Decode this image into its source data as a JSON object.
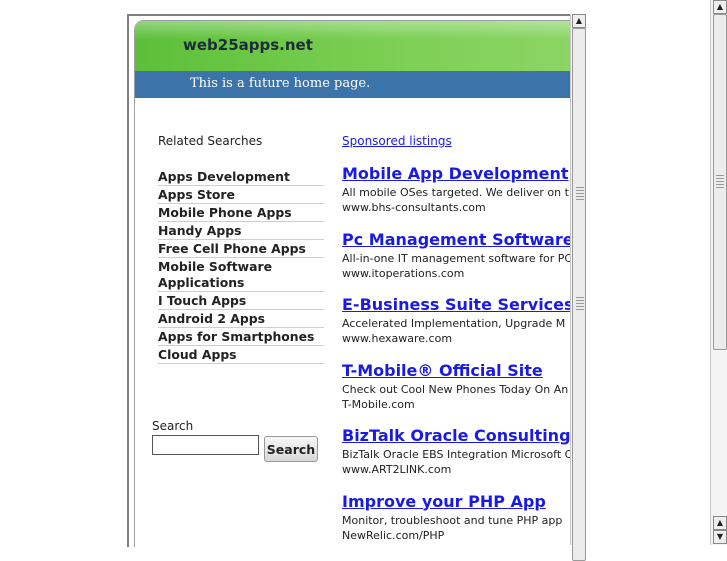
{
  "header": {
    "site_name": "web25apps.net",
    "tagline": "This is a future home page."
  },
  "related": {
    "title": "Related Searches",
    "items": [
      "Apps Development",
      "Apps Store",
      "Mobile Phone Apps",
      "Handy Apps",
      "Free Cell Phone Apps",
      "Mobile Software Applications",
      "I Touch Apps",
      "Android 2 Apps",
      "Apps for Smartphones",
      "Cloud Apps"
    ]
  },
  "search": {
    "label": "Search",
    "button": "Search",
    "value": ""
  },
  "sponsored": {
    "label": "Sponsored listings",
    "ads": [
      {
        "title": "Mobile App Development",
        "desc": "All mobile OSes targeted. We deliver on t",
        "url": "www.bhs-consultants.com"
      },
      {
        "title": "Pc Management Software",
        "desc": "All-in-one IT management software for PC",
        "url": "www.itoperations.com"
      },
      {
        "title": "E-Business Suite Services",
        "desc": "Accelerated Implementation, Upgrade M",
        "url": "www.hexaware.com"
      },
      {
        "title": "T-Mobile® Official Site",
        "desc": "Check out Cool New Phones Today On An",
        "url": "T-Mobile.com"
      },
      {
        "title": "BizTalk Oracle Consulting",
        "desc": "BizTalk Oracle EBS Integration Microsoft C",
        "url": "www.ART2LINK.com"
      },
      {
        "title": "Improve your PHP App",
        "desc": "Monitor, troubleshoot and tune PHP app",
        "url": "NewRelic.com/PHP"
      }
    ]
  },
  "colors": {
    "header_green": "#6cc748",
    "header_blue": "#3c73a8",
    "link": "#1a1ae6"
  },
  "icons": {
    "scroll_up": "▲",
    "scroll_down": "▼"
  }
}
